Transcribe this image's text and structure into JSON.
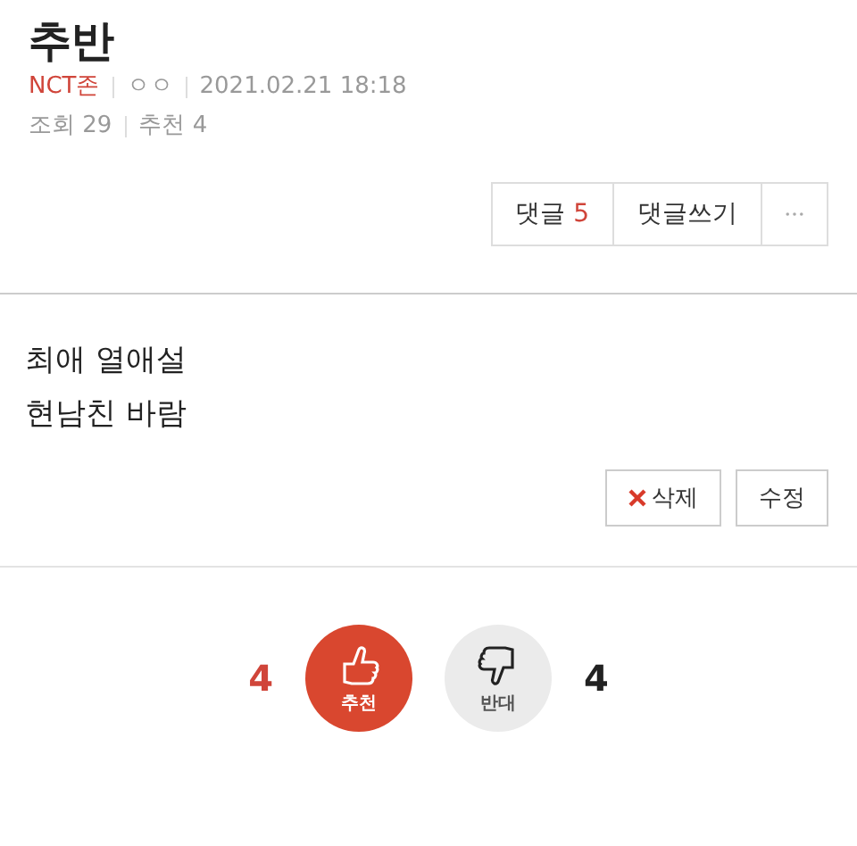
{
  "title": "추반",
  "meta": {
    "author": "NCT존",
    "nickname": "ㅇㅇ",
    "date": "2021.02.21 18:18",
    "views_label": "조회",
    "views": "29",
    "recommends_label": "추천",
    "recommends": "4"
  },
  "actions": {
    "comments_label": "댓글",
    "comments_count": "5",
    "write_comment": "댓글쓰기"
  },
  "content": [
    "최애 열애설",
    "현남친 바람"
  ],
  "post_buttons": [
    {
      "kind": "delete",
      "label": "삭제"
    },
    {
      "kind": "edit",
      "label": "수정"
    }
  ],
  "votes": [
    {
      "kind": "up",
      "label": "추천",
      "count": "4"
    },
    {
      "kind": "down",
      "label": "반대",
      "count": "4"
    }
  ]
}
